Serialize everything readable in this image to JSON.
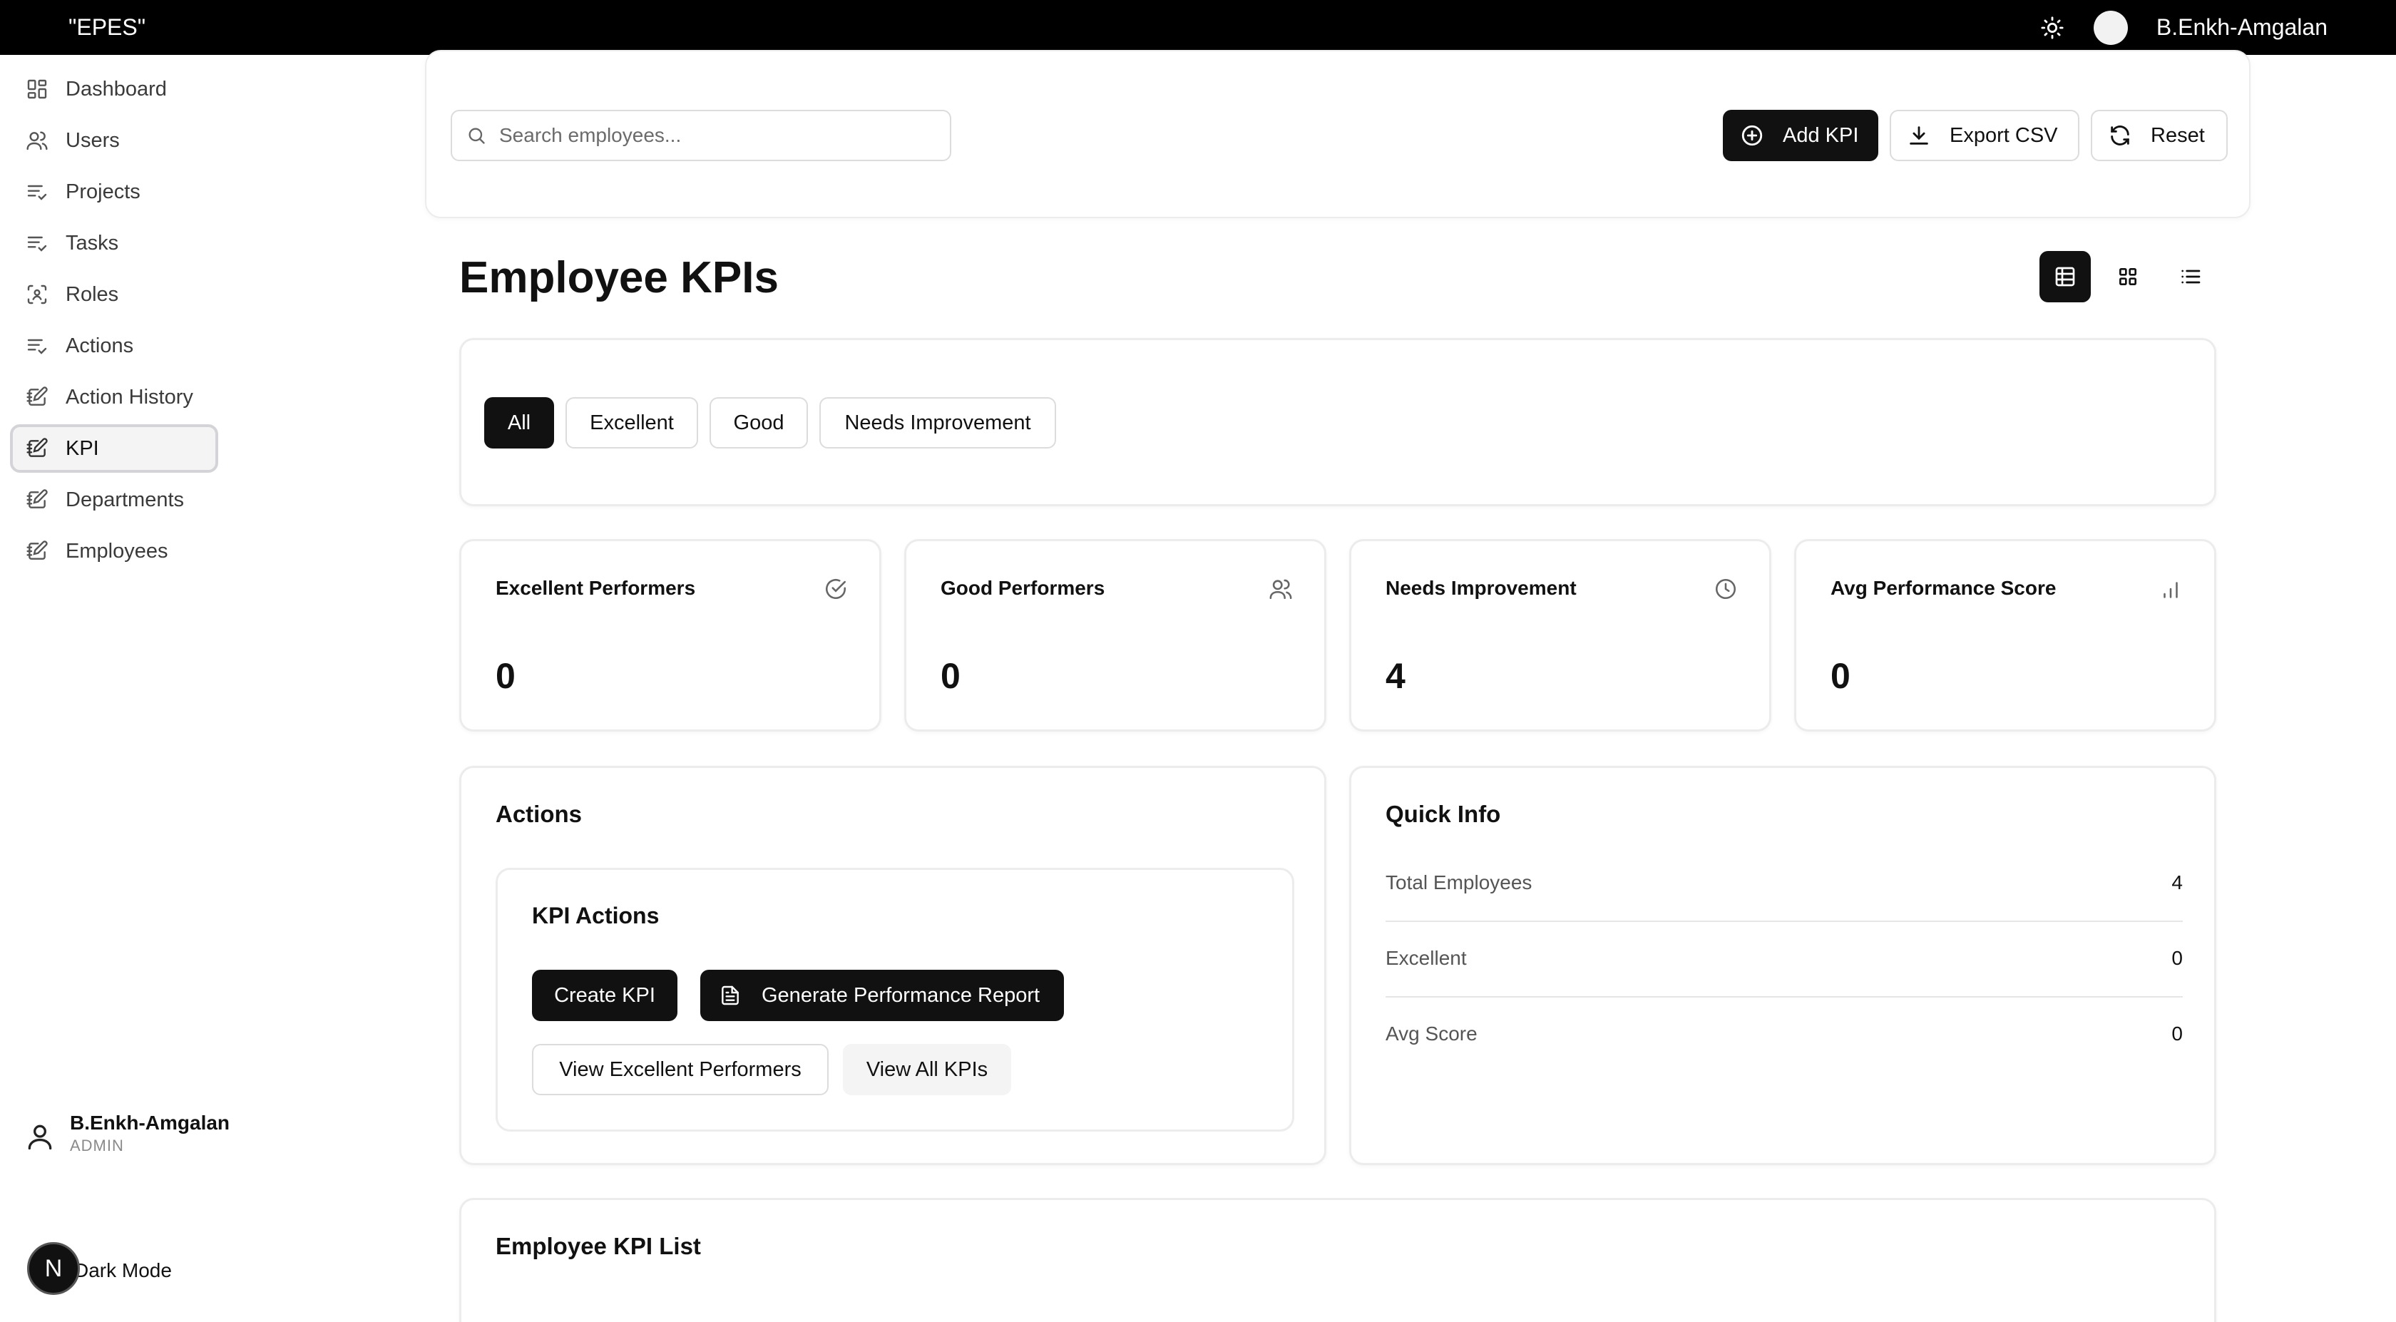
{
  "app": {
    "brand": "\"EPES\"",
    "user": "B.Enkh-Amgalan"
  },
  "sidebar": {
    "items": [
      {
        "label": "Dashboard",
        "icon": "dashboard-icon"
      },
      {
        "label": "Users",
        "icon": "users-icon"
      },
      {
        "label": "Projects",
        "icon": "list-check-icon"
      },
      {
        "label": "Tasks",
        "icon": "list-check-icon"
      },
      {
        "label": "Roles",
        "icon": "scan-user-icon"
      },
      {
        "label": "Actions",
        "icon": "list-check-icon"
      },
      {
        "label": "Action History",
        "icon": "notebook-pen-icon"
      },
      {
        "label": "KPI",
        "icon": "notebook-pen-icon",
        "active": true
      },
      {
        "label": "Departments",
        "icon": "notebook-pen-icon"
      },
      {
        "label": "Employees",
        "icon": "notebook-pen-icon"
      }
    ],
    "user_name": "B.Enkh-Amgalan",
    "user_role": "ADMIN",
    "dark_mode_label": "Dark Mode",
    "badge_letter": "N"
  },
  "toolbar": {
    "search_placeholder": "Search employees...",
    "add_label": "Add KPI",
    "export_label": "Export CSV",
    "reset_label": "Reset"
  },
  "page": {
    "title": "Employee KPIs"
  },
  "filters": [
    "All",
    "Excellent",
    "Good",
    "Needs Improvement"
  ],
  "stats": [
    {
      "title": "Excellent Performers",
      "value": "0",
      "icon": "circle-check-icon"
    },
    {
      "title": "Good Performers",
      "value": "0",
      "icon": "users-icon"
    },
    {
      "title": "Needs Improvement",
      "value": "4",
      "icon": "clock-icon"
    },
    {
      "title": "Avg Performance Score",
      "value": "0",
      "icon": "bar-chart-icon"
    }
  ],
  "actions": {
    "heading": "Actions",
    "sub_heading": "KPI Actions",
    "create_label": "Create KPI",
    "report_label": "Generate Performance Report",
    "view_excellent_label": "View Excellent Performers",
    "view_all_label": "View All KPIs"
  },
  "quick_info": {
    "heading": "Quick Info",
    "rows": [
      {
        "label": "Total Employees",
        "value": "4"
      },
      {
        "label": "Excellent",
        "value": "0"
      },
      {
        "label": "Avg Score",
        "value": "0"
      }
    ]
  },
  "list": {
    "heading": "Employee KPI List"
  },
  "colors": {
    "accent": "#111111",
    "topbar": "#000000",
    "border": "#ececec",
    "muted": "#6b6b6b"
  }
}
